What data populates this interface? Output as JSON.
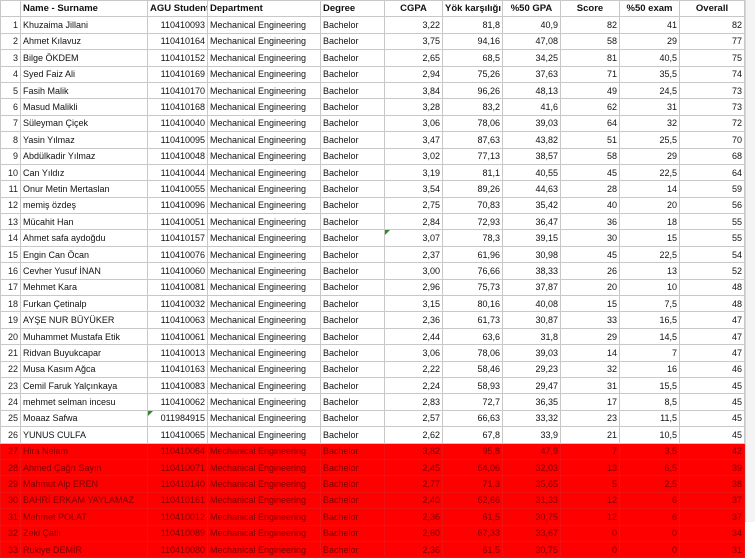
{
  "headers": [
    "",
    "Name - Surname",
    "AGU Student",
    "Department",
    "Degree",
    "CGPA",
    "Yök karşılığı",
    "%50 GPA",
    "Score",
    "%50 exam",
    "Overall"
  ],
  "rows": [
    [
      "1",
      "Khuzaima Jillani",
      "110410093",
      "Mechanical Engineering",
      "Bachelor",
      "3,22",
      "81,8",
      "40,9",
      "82",
      "41",
      "82"
    ],
    [
      "2",
      "Ahmet Kılavuz",
      "110410164",
      "Mechanical Engineering",
      "Bachelor",
      "3,75",
      "94,16",
      "47,08",
      "58",
      "29",
      "77"
    ],
    [
      "3",
      "Bilge ÖKDEM",
      "110410152",
      "Mechanical Engineering",
      "Bachelor",
      "2,65",
      "68,5",
      "34,25",
      "81",
      "40,5",
      "75"
    ],
    [
      "4",
      "Syed Faiz Ali",
      "110410169",
      "Mechanical Engineering",
      "Bachelor",
      "2,94",
      "75,26",
      "37,63",
      "71",
      "35,5",
      "74"
    ],
    [
      "5",
      "Fasih Malik",
      "110410170",
      "Mechanical Engineering",
      "Bachelor",
      "3,84",
      "96,26",
      "48,13",
      "49",
      "24,5",
      "73"
    ],
    [
      "6",
      "Masud Malikli",
      "110410168",
      "Mechanical Engineering",
      "Bachelor",
      "3,28",
      "83,2",
      "41,6",
      "62",
      "31",
      "73"
    ],
    [
      "7",
      "Süleyman Çiçek",
      "110410040",
      "Mechanical Engineering",
      "Bachelor",
      "3,06",
      "78,06",
      "39,03",
      "64",
      "32",
      "72"
    ],
    [
      "8",
      "Yasin Yılmaz",
      "110410095",
      "Mechanical Engineering",
      "Bachelor",
      "3,47",
      "87,63",
      "43,82",
      "51",
      "25,5",
      "70"
    ],
    [
      "9",
      "Abdülkadir Yılmaz",
      "110410048",
      "Mechanical Engineering",
      "Bachelor",
      "3,02",
      "77,13",
      "38,57",
      "58",
      "29",
      "68"
    ],
    [
      "10",
      "Can Yıldız",
      "110410044",
      "Mechanical Engineering",
      "Bachelor",
      "3,19",
      "81,1",
      "40,55",
      "45",
      "22,5",
      "64"
    ],
    [
      "11",
      "Onur Metin Mertaslan",
      "110410055",
      "Mechanical Engineering",
      "Bachelor",
      "3,54",
      "89,26",
      "44,63",
      "28",
      "14",
      "59"
    ],
    [
      "12",
      "memiş özdeş",
      "110410096",
      "Mechanical Engineering",
      "Bachelor",
      "2,75",
      "70,83",
      "35,42",
      "40",
      "20",
      "56"
    ],
    [
      "13",
      "Mücahit Han",
      "110410051",
      "Mechanical Engineering",
      "Bachelor",
      "2,84",
      "72,93",
      "36,47",
      "36",
      "18",
      "55"
    ],
    [
      "14",
      "Ahmet safa aydoğdu",
      "110410157",
      "Mechanical Engineering",
      "Bachelor",
      "3,07",
      "78,3",
      "39,15",
      "30",
      "15",
      "55"
    ],
    [
      "15",
      "Engin Can Öcan",
      "110410076",
      "Mechanical Engineering",
      "Bachelor",
      "2,37",
      "61,96",
      "30,98",
      "45",
      "22,5",
      "54"
    ],
    [
      "16",
      "Cevher Yusuf İNAN",
      "110410060",
      "Mechanical Engineering",
      "Bachelor",
      "3,00",
      "76,66",
      "38,33",
      "26",
      "13",
      "52"
    ],
    [
      "17",
      "Mehmet Kara",
      "110410081",
      "Mechanical Engineering",
      "Bachelor",
      "2,96",
      "75,73",
      "37,87",
      "20",
      "10",
      "48"
    ],
    [
      "18",
      "Furkan Çetinalp",
      "110410032",
      "Mechanical Engineering",
      "Bachelor",
      "3,15",
      "80,16",
      "40,08",
      "15",
      "7,5",
      "48"
    ],
    [
      "19",
      "AYŞE NUR BÜYÜKER",
      "110410063",
      "Mechanical Engineering",
      "Bachelor",
      "2,36",
      "61,73",
      "30,87",
      "33",
      "16,5",
      "47"
    ],
    [
      "20",
      "Muhammet Mustafa Etik",
      "110410061",
      "Mechanical Engineering",
      "Bachelor",
      "2,44",
      "63,6",
      "31,8",
      "29",
      "14,5",
      "47"
    ],
    [
      "21",
      "Ridvan Buyukcapar",
      "110410013",
      "Mechanical Engineering",
      "Bachelor",
      "3,06",
      "78,06",
      "39,03",
      "14",
      "7",
      "47"
    ],
    [
      "22",
      "Musa Kasım Ağca",
      "110410163",
      "Mechanical Engineering",
      "Bachelor",
      "2,22",
      "58,46",
      "29,23",
      "32",
      "16",
      "46"
    ],
    [
      "23",
      "Cemil Faruk Yalçınkaya",
      "110410083",
      "Mechanical Engineering",
      "Bachelor",
      "2,24",
      "58,93",
      "29,47",
      "31",
      "15,5",
      "45"
    ],
    [
      "24",
      "mehmet selman incesu",
      "110410062",
      "Mechanical Engineering",
      "Bachelor",
      "2,83",
      "72,7",
      "36,35",
      "17",
      "8,5",
      "45"
    ],
    [
      "25",
      "Moaaz Safwa",
      "011984915",
      "Mechanical Engineering",
      "Bachelor",
      "2,57",
      "66,63",
      "33,32",
      "23",
      "11,5",
      "45"
    ],
    [
      "26",
      "YUNUS CULFA",
      "110410065",
      "Mechanical Engineering",
      "Bachelor",
      "2,62",
      "67,8",
      "33,9",
      "21",
      "10,5",
      "45"
    ],
    [
      "27",
      "Hira Nelam",
      "110410064",
      "Mechanical Engineering",
      "Bachelor",
      "3,82",
      "95,8",
      "47,9",
      "7",
      "3,5",
      "42"
    ],
    [
      "28",
      "Ahmed Çağrı Sayın",
      "110410071",
      "Mechanical Engineering",
      "Bachelor",
      "2,45",
      "64,06",
      "32,03",
      "13",
      "6,5",
      "39"
    ],
    [
      "29",
      "Mahmut Alp EREN",
      "110410140",
      "Mechanical Engineering",
      "Bachelor",
      "2,77",
      "71,3",
      "35,65",
      "5",
      "2,5",
      "38"
    ],
    [
      "30",
      "BAHRİ ERKAM YAYLAMAZ",
      "110410161",
      "Mechanical Engineering",
      "Bachelor",
      "2,40",
      "62,66",
      "31,33",
      "12",
      "6",
      "37"
    ],
    [
      "31",
      "Mehmet POLAT",
      "110410012",
      "Mechanical Engineering",
      "Bachelor",
      "2,36",
      "61,5",
      "30,75",
      "12",
      "6",
      "37"
    ],
    [
      "32",
      "Zeki Çatlı",
      "110410089",
      "Mechanical Engineering",
      "Bachelor",
      "2,60",
      "67,33",
      "33,67",
      "0",
      "0",
      "34"
    ],
    [
      "33",
      "Rukiye DEMİR",
      "110410080",
      "Mechanical Engineering",
      "Bachelor",
      "2,36",
      "61,5",
      "30,75",
      "0",
      "0",
      "31"
    ]
  ],
  "highlight_from_row": 27,
  "highlight_color": "#ff0000"
}
